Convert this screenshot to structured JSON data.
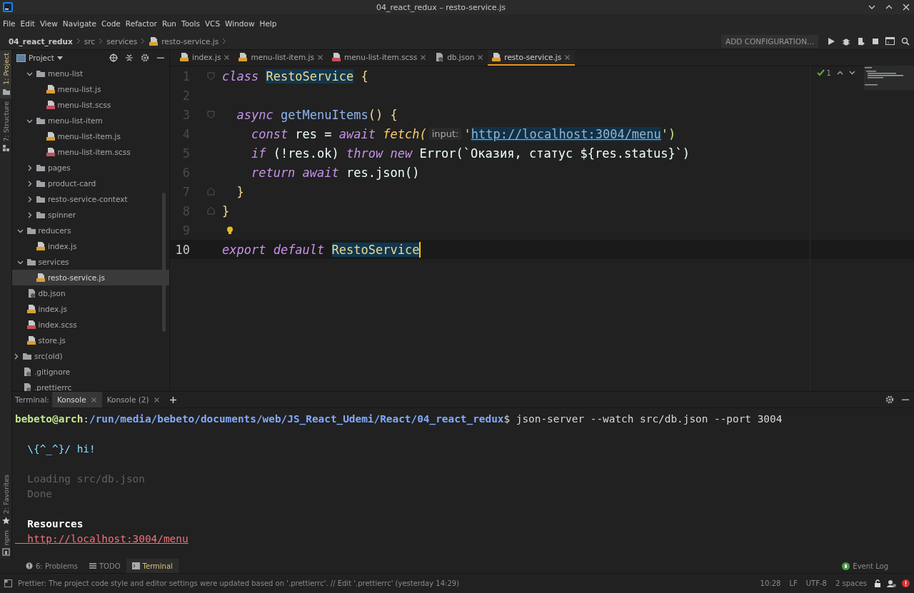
{
  "window": {
    "title": "04_react_redux – resto-service.js"
  },
  "menu": [
    "File",
    "Edit",
    "View",
    "Navigate",
    "Code",
    "Refactor",
    "Run",
    "Tools",
    "VCS",
    "Window",
    "Help"
  ],
  "breadcrumbs": [
    {
      "label": "04_react_redux",
      "kind": "project"
    },
    {
      "label": "src",
      "kind": "folder"
    },
    {
      "label": "services",
      "kind": "folder"
    },
    {
      "label": "resto-service.js",
      "kind": "js"
    }
  ],
  "run_toolbar": {
    "configuration": "ADD CONFIGURATION..."
  },
  "side_stripe": {
    "top": [
      {
        "label": "1: Project",
        "kind": "project",
        "selected": true
      },
      {
        "label": "7: Structure",
        "kind": "structure",
        "selected": false
      }
    ],
    "bottom": [
      {
        "label": "2: Favorites",
        "kind": "favorites",
        "selected": false
      },
      {
        "label": "npm",
        "kind": "npm",
        "selected": false
      }
    ]
  },
  "project_panel": {
    "title": "Project",
    "tree": [
      {
        "children": [
          {
            "children": [
              {
                "label": "menu-list",
                "kind": "folder",
                "expanded": true,
                "selected": false,
                "children": [
                  {
                    "label": "menu-list.js",
                    "kind": "js",
                    "selected": false
                  },
                  {
                    "label": "menu-list.scss",
                    "kind": "scss",
                    "selected": false
                  }
                ]
              },
              {
                "label": "menu-list-item",
                "kind": "folder",
                "expanded": true,
                "selected": false,
                "children": [
                  {
                    "label": "menu-list-item.js",
                    "kind": "js",
                    "selected": false
                  },
                  {
                    "label": "menu-list-item.scss",
                    "kind": "scss",
                    "selected": false
                  }
                ]
              },
              {
                "label": "pages",
                "kind": "folder",
                "expanded": false,
                "selected": false
              },
              {
                "label": "product-card",
                "kind": "folder",
                "expanded": false,
                "selected": false
              },
              {
                "label": "resto-service-context",
                "kind": "folder",
                "expanded": false,
                "selected": false
              },
              {
                "label": "spinner",
                "kind": "folder",
                "expanded": false,
                "selected": false
              }
            ]
          },
          {
            "label": "reducers",
            "kind": "folder",
            "expanded": true,
            "selected": false,
            "children": [
              {
                "label": "index.js",
                "kind": "js",
                "selected": false
              }
            ]
          },
          {
            "label": "services",
            "kind": "folder",
            "expanded": true,
            "selected": false,
            "children": [
              {
                "label": "resto-service.js",
                "kind": "js",
                "selected": true
              }
            ]
          },
          {
            "label": "db.json",
            "kind": "json",
            "selected": false
          },
          {
            "label": "index.js",
            "kind": "js",
            "selected": false
          },
          {
            "label": "index.scss",
            "kind": "scss",
            "selected": false
          },
          {
            "label": "store.js",
            "kind": "js",
            "selected": false
          }
        ]
      },
      {
        "label": "src(old)",
        "kind": "folder",
        "expanded": false,
        "selected": false
      },
      {
        "label": ".gitignore",
        "kind": "config",
        "selected": false
      },
      {
        "label": ".prettierrc",
        "kind": "config",
        "selected": false
      }
    ]
  },
  "editor_tabs": [
    {
      "label": "index.js",
      "kind": "js",
      "selected": false
    },
    {
      "label": "menu-list-item.js",
      "kind": "js",
      "selected": false
    },
    {
      "label": "menu-list-item.scss",
      "kind": "scss",
      "selected": false
    },
    {
      "label": "db.json",
      "kind": "json",
      "selected": false
    },
    {
      "label": "resto-service.js",
      "kind": "js",
      "selected": true
    }
  ],
  "inspections": {
    "count": "1"
  },
  "code": {
    "lines": [
      {
        "number": "1",
        "kind": "fold-start",
        "current": false,
        "tokens": [
          {
            "text": "class ",
            "kind": "kw"
          },
          {
            "text": "RestoService",
            "kind": "mark"
          },
          {
            "text": " {",
            "kind": "punct"
          }
        ]
      },
      {
        "number": "2",
        "kind": "plain",
        "current": false
      },
      {
        "number": "3",
        "kind": "fold-start",
        "current": false,
        "tokens": [
          {
            "text": "  async ",
            "kind": "kw"
          },
          {
            "text": "getMenuItems",
            "kind": "method"
          },
          {
            "text": "() {",
            "kind": "punct"
          }
        ]
      },
      {
        "number": "4",
        "kind": "plain",
        "current": false,
        "tokens": [
          {
            "text": "    const",
            "kind": "kw"
          },
          {
            "text": " res = ",
            "kind": "plain"
          },
          {
            "text": "await ",
            "kind": "kw"
          },
          {
            "text": "fetch(",
            "kind": "call"
          },
          {
            "text": "input:",
            "kind": "hint"
          },
          {
            "text": "'",
            "kind": "str"
          },
          {
            "text": "http://localhost:3004/menu",
            "kind": "url"
          },
          {
            "text": "')",
            "kind": "str"
          }
        ]
      },
      {
        "number": "5",
        "kind": "plain",
        "current": false,
        "tokens": [
          {
            "text": "    if",
            "kind": "kw"
          },
          {
            "text": " (!res.ok) ",
            "kind": "plain"
          },
          {
            "text": "throw ",
            "kind": "kw"
          },
          {
            "text": "new",
            "kind": "kw"
          },
          {
            "text": " Error(`Оказия, статус ${res.status}`)",
            "kind": "plain"
          }
        ]
      },
      {
        "number": "6",
        "kind": "plain",
        "current": false,
        "tokens": [
          {
            "text": "    return ",
            "kind": "kw"
          },
          {
            "text": "await",
            "kind": "kw"
          },
          {
            "text": " res.json()",
            "kind": "plain"
          }
        ]
      },
      {
        "number": "7",
        "kind": "fold-end",
        "current": false,
        "tokens": [
          {
            "text": "  }",
            "kind": "punct"
          }
        ]
      },
      {
        "number": "8",
        "kind": "fold-end",
        "current": false,
        "tokens": [
          {
            "text": "}",
            "kind": "punct"
          }
        ]
      },
      {
        "number": "9",
        "kind": "plain",
        "bulb": true,
        "current": false
      },
      {
        "number": "10",
        "kind": "plain",
        "current": true,
        "tokens": [
          {
            "text": "export ",
            "kind": "kw"
          },
          {
            "text": "default ",
            "kind": "kw"
          },
          {
            "text": "RestoService",
            "kind": "mark"
          }
        ]
      }
    ]
  },
  "terminal": {
    "title": "Terminal:",
    "tabs": [
      {
        "label": "Konsole",
        "selected": true
      },
      {
        "label": "Konsole (2)",
        "selected": false
      }
    ],
    "lines": [
      {
        "spans": [
          {
            "text": "bebeto@arch",
            "kind": "user"
          },
          {
            "text": ":",
            "kind": "plain"
          },
          {
            "text": "/run/media/bebeto/documents/web/JS_React_Udemi/React/04_react_redux",
            "kind": "path"
          },
          {
            "text": "$ json-server --watch src/db.json --port 3004",
            "kind": "plain"
          }
        ]
      },
      {
        "blank_before": true,
        "spans": [
          {
            "text": "  \\{^_^}/ hi!",
            "kind": "cyan"
          }
        ]
      },
      {
        "blank_before": true,
        "spans": [
          {
            "text": "  Loading src/db.json",
            "kind": "dim"
          }
        ]
      },
      {
        "spans": [
          {
            "text": "  Done",
            "kind": "dim"
          }
        ]
      },
      {
        "blank_before": true,
        "spans": [
          {
            "text": "  Resources",
            "kind": "bold"
          }
        ]
      },
      {
        "spans": [
          {
            "text": "  http://localhost:3004/menu",
            "kind": "link"
          }
        ]
      }
    ]
  },
  "tool_tabs": [
    {
      "label": "6: Problems",
      "kind": "problems",
      "selected": false
    },
    {
      "label": "TODO",
      "kind": "todo",
      "selected": false
    },
    {
      "label": "Terminal",
      "kind": "terminal",
      "selected": true
    }
  ],
  "event_log": {
    "label": "Event Log"
  },
  "status_bar": {
    "message": "Prettier: The project code style and editor settings were updated based on '.prettierrc'. // Edit '.prettierrc' (yesterday 14:29)",
    "items": [
      "10:28",
      "LF",
      "UTF-8",
      "2 spaces"
    ]
  }
}
